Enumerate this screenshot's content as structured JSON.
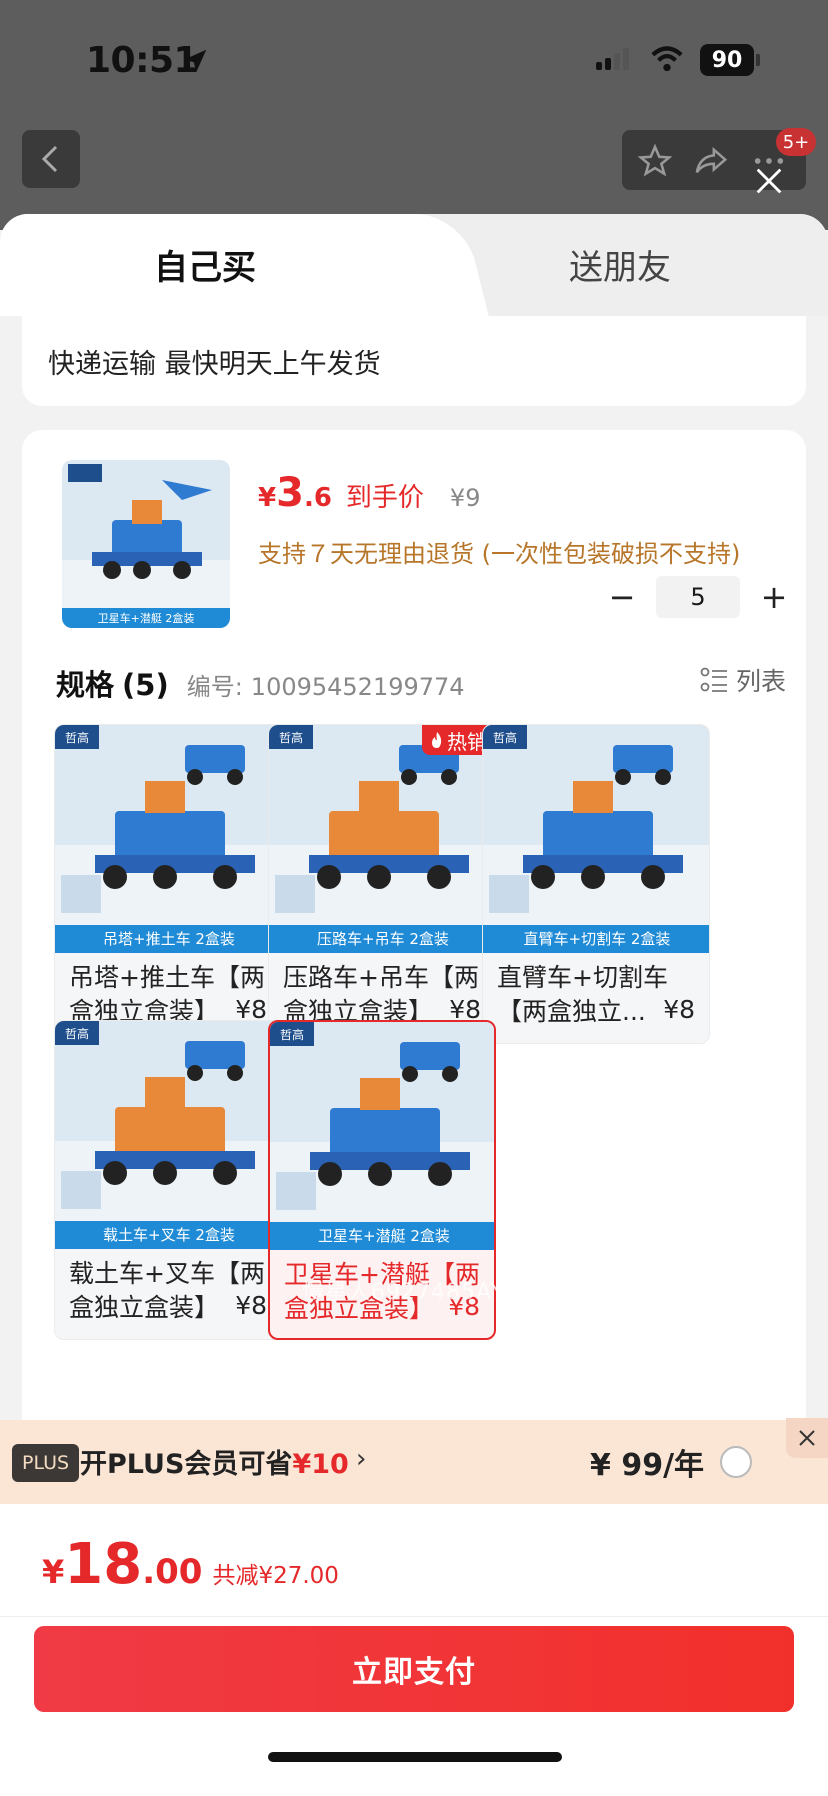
{
  "status_bar": {
    "time": "10:51",
    "battery": "90"
  },
  "nav": {
    "badge": "5+"
  },
  "tabs": [
    {
      "label": "自己买"
    },
    {
      "label": "送朋友"
    }
  ],
  "shipping": {
    "text": "快递运输 最快明天上午发货"
  },
  "product": {
    "thumb_caption": "卫星车+潜艇 2盒装",
    "price_yen": "¥",
    "price_int": "3",
    "price_dec": ".6",
    "price_tag": "到手价",
    "orig_price": "¥9",
    "return_policy": "支持７天无理由退货 (一次性包装破损不支持)",
    "qty_minus": "−",
    "quantity": "5",
    "qty_plus": "+"
  },
  "spec": {
    "title": "规格",
    "count": "(5)",
    "code_label": "编号:",
    "code": "10095452199774",
    "view_toggle": "列表"
  },
  "options": [
    {
      "caption": "吊塔+推土车 2盒装",
      "name": "吊塔+推土车【两盒独立盒装】",
      "price": "¥8",
      "hot": false,
      "selected": false
    },
    {
      "caption": "压路车+吊车 2盒装",
      "name": "压路车+吊车【两盒独立盒装】",
      "price": "¥8",
      "hot": true,
      "selected": false
    },
    {
      "caption": "直臂车+切割车 2盒装",
      "name": "直臂车+切割车【两盒独立...",
      "price": "¥8",
      "hot": false,
      "selected": false
    },
    {
      "caption": "载土车+叉车 2盒装",
      "name": "载土车+叉车【两盒独立盒装】",
      "price": "¥8",
      "hot": false,
      "selected": false
    },
    {
      "caption": "卫星车+潜艇 2盒装",
      "name": "卫星车+潜艇【两盒独立盒装】",
      "price": "¥8",
      "hot": false,
      "selected": true
    }
  ],
  "hot_label": "热销",
  "brand_logo": "哲高",
  "watermark": "慢星人6927485AY",
  "plus": {
    "tag": "PLUS",
    "text_prefix": "开PLUS会员可省",
    "save": "¥10",
    "arrow": "›",
    "price": "¥ 99/年"
  },
  "checkout": {
    "yen": "¥",
    "total_int": "18",
    "total_dec": ".00",
    "saved": "共减¥27.00",
    "pay_label": "立即支付"
  },
  "colors": {
    "accent": "#e5282a",
    "gold": "#b7762a",
    "plus_bg": "#fbe6d6"
  }
}
